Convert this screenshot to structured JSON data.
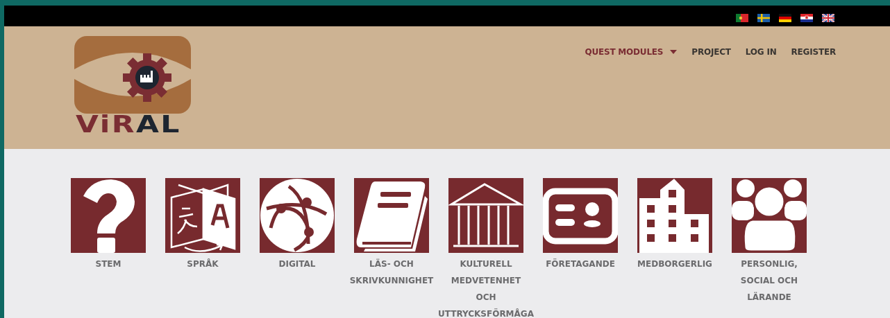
{
  "top_bar": {
    "languages": [
      {
        "kind": "pt"
      },
      {
        "kind": "se"
      },
      {
        "kind": "de"
      },
      {
        "kind": "hr"
      },
      {
        "kind": "gb"
      }
    ]
  },
  "logo": {
    "text_a": "Vi",
    "text_b": "R",
    "text_c": "AL"
  },
  "nav": [
    {
      "label": "QUEST MODULES",
      "selected": true,
      "dropdown": true
    },
    {
      "label": "PROJECT",
      "selected": false,
      "dropdown": false
    },
    {
      "label": "LOG IN",
      "selected": false,
      "dropdown": false
    },
    {
      "label": "REGISTER",
      "selected": false,
      "dropdown": false
    }
  ],
  "modules": [
    {
      "kind": "question",
      "lines": [
        "STEM"
      ]
    },
    {
      "kind": "translate",
      "lines": [
        "SPRÅK"
      ]
    },
    {
      "kind": "network",
      "lines": [
        "DIGITAL"
      ]
    },
    {
      "kind": "book",
      "lines": [
        "LÄS- OCH",
        "SKRIVKUNNIGHET"
      ]
    },
    {
      "kind": "museum",
      "lines": [
        "KULTURELL",
        "MEDVETENHET",
        "OCH",
        "UTTRYCKSFÖRMÅGA"
      ]
    },
    {
      "kind": "card",
      "lines": [
        "FÖRETAGANDE"
      ]
    },
    {
      "kind": "building",
      "lines": [
        "MEDBORGERLIG"
      ]
    },
    {
      "kind": "people",
      "lines": [
        "PERSONLIG,",
        "SOCIAL OCH",
        "LÄRANDE"
      ]
    }
  ]
}
